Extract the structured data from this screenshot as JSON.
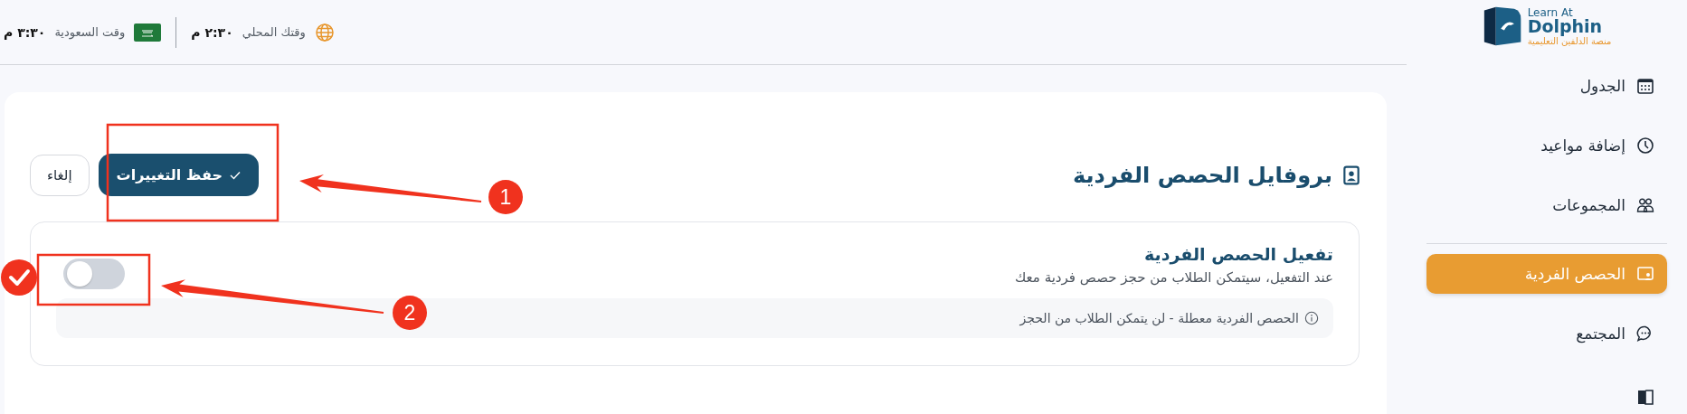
{
  "top_bar": {
    "local_time": {
      "label": "وقتك المحلي",
      "time": "٢:٣٠ م"
    },
    "saudi_time": {
      "label": "وقت السعودية",
      "time": "٣:٣٠ م"
    }
  },
  "sidebar": {
    "logo": {
      "line1": "Learn At",
      "line2": "Dolphin",
      "tagline": "منصة الدلفين التعليمية"
    },
    "items": [
      {
        "label": "الجدول",
        "selected": false
      },
      {
        "label": "إضافة مواعيد",
        "selected": false
      },
      {
        "label": "المجموعات",
        "selected": false
      },
      {
        "label": "الحصص الفردية",
        "selected": true
      },
      {
        "label": "المجتمع",
        "selected": false
      }
    ]
  },
  "page": {
    "title": "بروفايل الحصص الفردية",
    "save_button": "حفظ التغييرات",
    "cancel_button": "إلغاء",
    "setting": {
      "title": "تفعيل الحصص الفردية",
      "description": "عند التفعيل، سيتمكن الطلاب من حجز حصص فردية معك",
      "on": false,
      "note": "الحصص الفردية معطلة - لن يتمكن الطلاب من الحجز"
    }
  },
  "annotations": [
    {
      "number": "1"
    },
    {
      "number": "2"
    }
  ]
}
